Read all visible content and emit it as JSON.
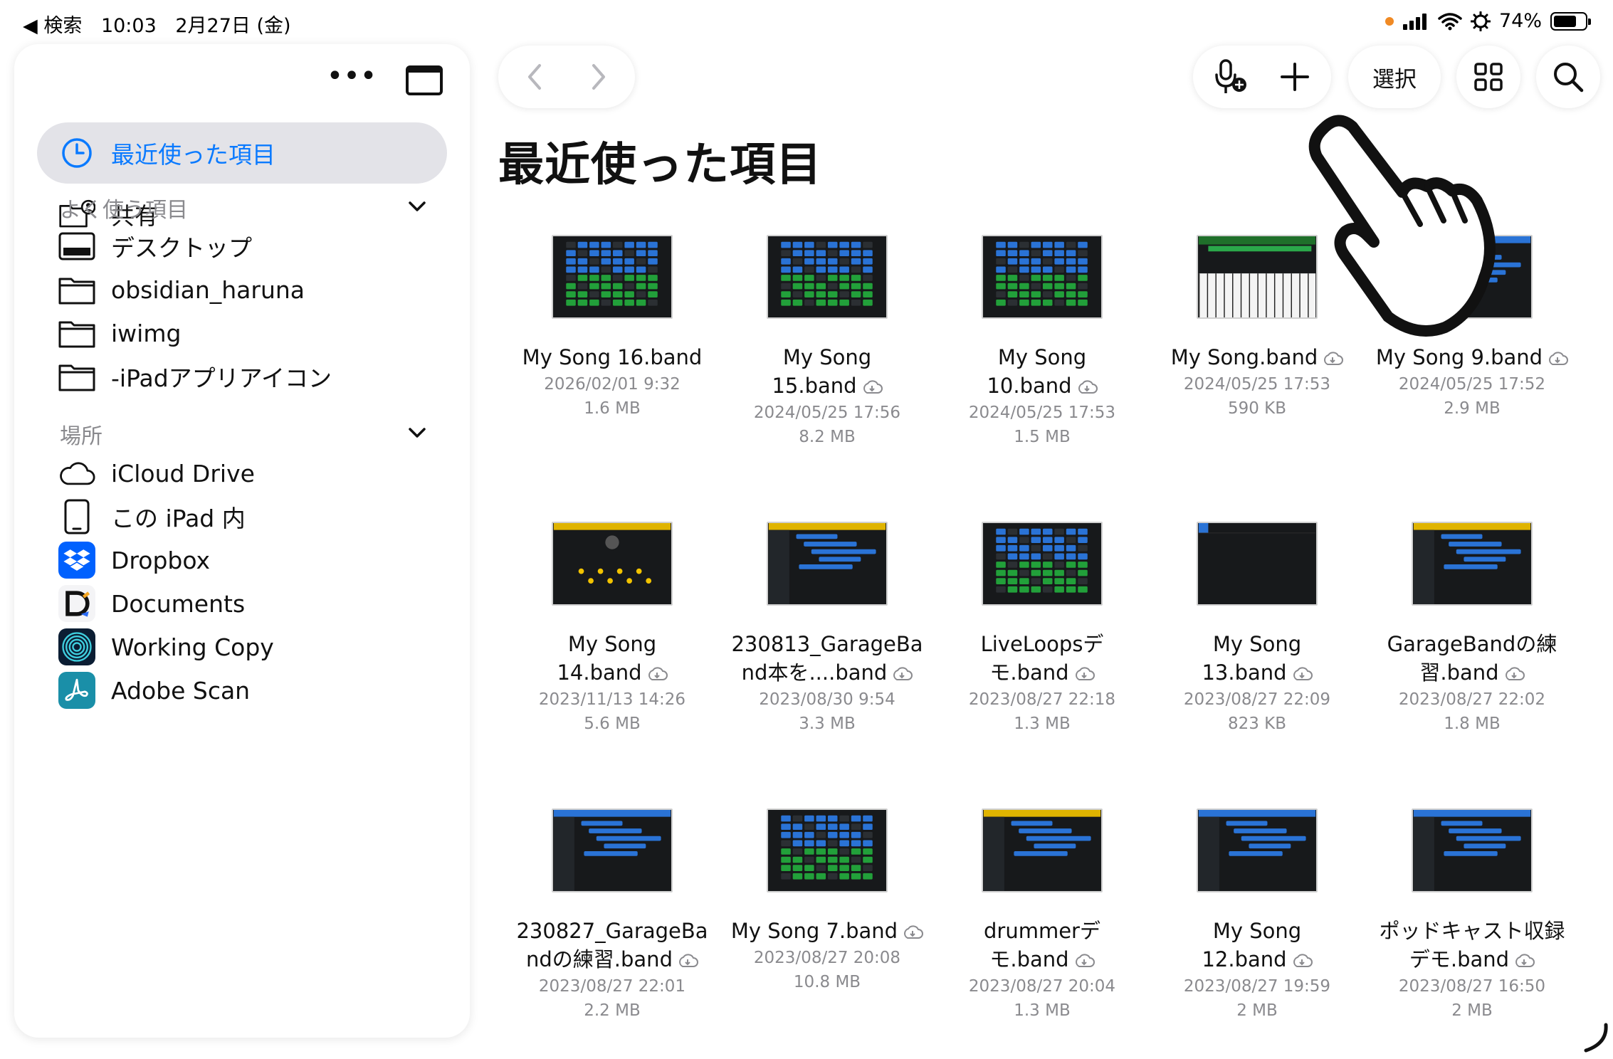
{
  "status": {
    "back_label": "◀ 検索",
    "time": "10:03",
    "date": "2月27日 (金)",
    "battery": "74%",
    "battery_level": 0.74,
    "colors": {
      "recording_dot": "#f08a24"
    }
  },
  "sidebar": {
    "more_label": "•••",
    "items_top": [
      {
        "label": "最近使った項目",
        "icon": "clock-icon",
        "active": true
      },
      {
        "label": "共有",
        "icon": "shared-folder-icon",
        "active": false
      }
    ],
    "favorites_header": "よく使う項目",
    "favorites": [
      {
        "label": "デスクトップ",
        "icon": "desktop-icon"
      },
      {
        "label": "obsidian_haruna",
        "icon": "folder-icon"
      },
      {
        "label": "iwimg",
        "icon": "folder-icon"
      },
      {
        "label": "-iPadアプリアイコン",
        "icon": "folder-icon"
      }
    ],
    "locations_header": "場所",
    "locations": [
      {
        "label": "iCloud Drive",
        "icon": "cloud-icon"
      },
      {
        "label": "この iPad 内",
        "icon": "ipad-icon"
      },
      {
        "label": "Dropbox",
        "icon": "dropbox-icon"
      },
      {
        "label": "Documents",
        "icon": "documents-app-icon"
      },
      {
        "label": "Working Copy",
        "icon": "working-copy-icon"
      },
      {
        "label": "Adobe Scan",
        "icon": "adobe-scan-icon"
      }
    ],
    "colors": {
      "accent": "#0a7aff",
      "active_bg": "#e3e3e8",
      "dropbox": "#0061fe",
      "adobe": "#1a8fa8"
    }
  },
  "toolbar": {
    "select_label": "選択"
  },
  "page": {
    "title": "最近使った項目"
  },
  "files": [
    {
      "name_lines": [
        "My Song 16.band"
      ],
      "date": "2026/02/01 9:32",
      "size": "1.6 MB",
      "cloud": false,
      "thumb": "grid"
    },
    {
      "name_lines": [
        "My Song",
        "15.band"
      ],
      "date": "2024/05/25 17:56",
      "size": "8.2 MB",
      "cloud": true,
      "thumb": "grid"
    },
    {
      "name_lines": [
        "My Song",
        "10.band"
      ],
      "date": "2024/05/25 17:53",
      "size": "1.5 MB",
      "cloud": true,
      "thumb": "grid"
    },
    {
      "name_lines": [
        "My Song.band"
      ],
      "date": "2024/05/25 17:53",
      "size": "590 KB",
      "cloud": true,
      "thumb": "keys"
    },
    {
      "name_lines": [
        "My Song 9.band"
      ],
      "date": "2024/05/25 17:52",
      "size": "2.9 MB",
      "cloud": true,
      "thumb": "tracks"
    },
    {
      "name_lines": [
        "My Song",
        "14.band"
      ],
      "date": "2023/11/13 14:26",
      "size": "5.6 MB",
      "cloud": true,
      "thumb": "drummer"
    },
    {
      "name_lines": [
        "230813_GarageBa",
        "nd本を....band"
      ],
      "date": "2023/08/30 9:54",
      "size": "3.3 MB",
      "cloud": true,
      "thumb": "tracks"
    },
    {
      "name_lines": [
        "LiveLoopsデ",
        "モ.band"
      ],
      "date": "2023/08/27 22:18",
      "size": "1.3 MB",
      "cloud": true,
      "thumb": "grid"
    },
    {
      "name_lines": [
        "My Song",
        "13.band"
      ],
      "date": "2023/08/27 22:09",
      "size": "823 KB",
      "cloud": true,
      "thumb": "empty"
    },
    {
      "name_lines": [
        "GarageBandの練",
        "習.band"
      ],
      "date": "2023/08/27 22:02",
      "size": "1.8 MB",
      "cloud": true,
      "thumb": "tracks"
    },
    {
      "name_lines": [
        "230827_GarageBa",
        "ndの練習.band"
      ],
      "date": "2023/08/27 22:01",
      "size": "2.2 MB",
      "cloud": true,
      "thumb": "tracks"
    },
    {
      "name_lines": [
        "My Song 7.band"
      ],
      "date": "2023/08/27 20:08",
      "size": "10.8 MB",
      "cloud": true,
      "thumb": "grid"
    },
    {
      "name_lines": [
        "drummerデ",
        "モ.band"
      ],
      "date": "2023/08/27 20:04",
      "size": "1.3 MB",
      "cloud": true,
      "thumb": "tracks"
    },
    {
      "name_lines": [
        "My Song",
        "12.band"
      ],
      "date": "2023/08/27 19:59",
      "size": "2 MB",
      "cloud": true,
      "thumb": "tracks"
    },
    {
      "name_lines": [
        "ポッドキャスト収録",
        "デモ.band"
      ],
      "date": "2023/08/27 16:50",
      "size": "2 MB",
      "cloud": true,
      "thumb": "tracks"
    }
  ]
}
